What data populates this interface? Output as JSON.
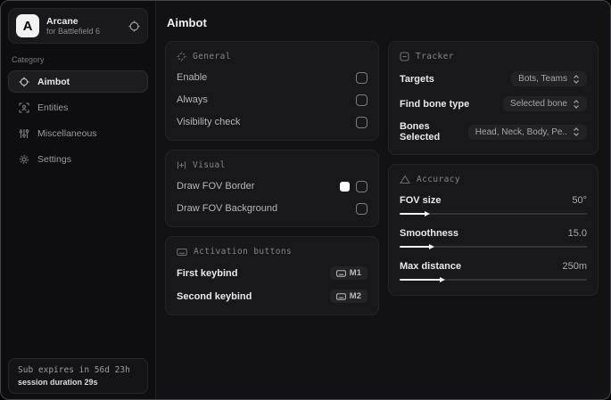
{
  "brand": {
    "logo_letter": "A",
    "title": "Arcane",
    "subtitle": "for Battlefield 6"
  },
  "sidebar": {
    "category_label": "Category",
    "items": [
      {
        "label": "Aimbot",
        "icon": "crosshair-icon",
        "active": true
      },
      {
        "label": "Entities",
        "icon": "entities-icon",
        "active": false
      },
      {
        "label": "Miscellaneous",
        "icon": "sliders-icon",
        "active": false
      },
      {
        "label": "Settings",
        "icon": "gear-icon",
        "active": false
      }
    ],
    "subscription": {
      "expires": "Sub expires in 56d 23h",
      "session": "session duration 29s"
    }
  },
  "main": {
    "title": "Aimbot",
    "cards": {
      "general": {
        "header": "General",
        "rows": [
          {
            "label": "Enable",
            "checked": false
          },
          {
            "label": "Always",
            "checked": false
          },
          {
            "label": "Visibility check",
            "checked": false
          }
        ]
      },
      "visual": {
        "header": "Visual",
        "rows": [
          {
            "label": "Draw FOV Border",
            "swatch_color": "#ffffff",
            "checked": false
          },
          {
            "label": "Draw FOV Background",
            "checked": false
          }
        ]
      },
      "activation": {
        "header": "Activation buttons",
        "rows": [
          {
            "label": "First keybind",
            "key": "M1"
          },
          {
            "label": "Second keybind",
            "key": "M2"
          }
        ]
      },
      "tracker": {
        "header": "Tracker",
        "rows": [
          {
            "label": "Targets",
            "value": "Bots, Teams"
          },
          {
            "label": "Find bone type",
            "value": "Selected bone"
          },
          {
            "label": "Bones Selected",
            "value": "Head, Neck, Body, Pe.."
          }
        ]
      },
      "accuracy": {
        "header": "Accuracy",
        "sliders": [
          {
            "label": "FOV size",
            "value": "50°",
            "percent": 14
          },
          {
            "label": "Smoothness",
            "value": "15.0",
            "percent": 16
          },
          {
            "label": "Max distance",
            "value": "250m",
            "percent": 22
          }
        ]
      }
    }
  },
  "colors": {
    "accent_swatch": "#ffffff",
    "card_bg": "#18181b",
    "sidebar_bg": "#0e0e10",
    "window_bg": "#121214"
  }
}
